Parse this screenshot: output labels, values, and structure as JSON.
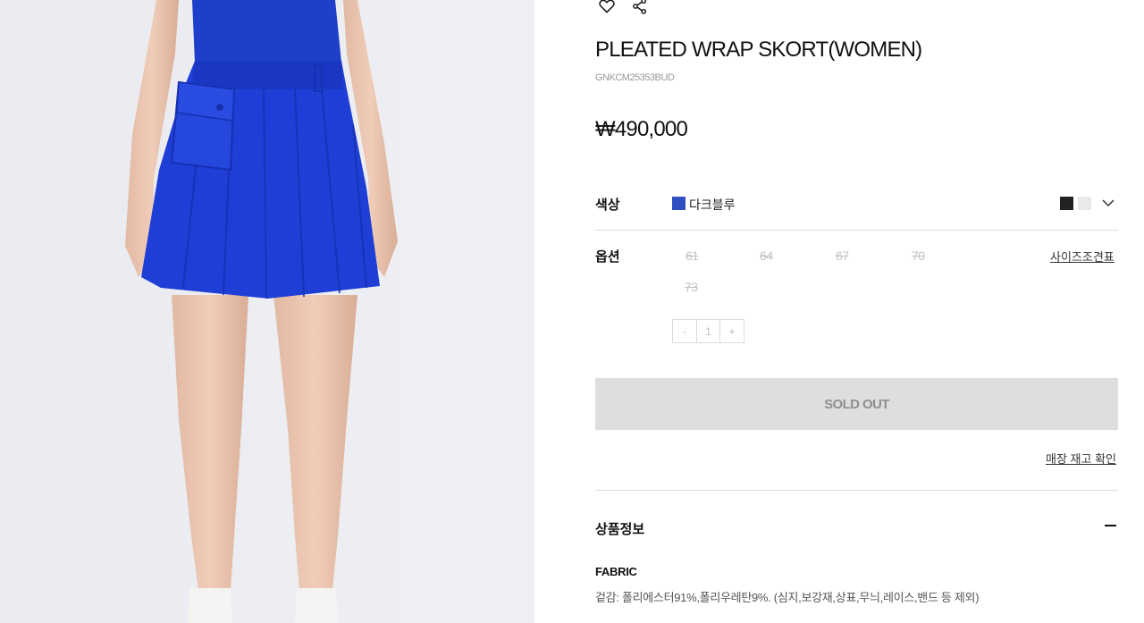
{
  "product": {
    "name": "PLEATED WRAP SKORT(WOMEN)",
    "code": "GNKCM25353BUD",
    "price": "₩490,000"
  },
  "icons": {
    "wishlist": "heart-icon",
    "share": "share-icon",
    "expand": "chevron-down-icon",
    "collapse": "minus-icon"
  },
  "color": {
    "label": "색상",
    "selected_name": "다크블루",
    "selected_hex": "#2f4ec2",
    "swatches": [
      "#222222",
      "#e9e9e9"
    ]
  },
  "options": {
    "label": "옵션",
    "sizes": [
      "61",
      "64",
      "67",
      "70",
      "73"
    ],
    "size_guide": "사이즈조견표"
  },
  "quantity": {
    "minus": "-",
    "value": "1",
    "plus": "+"
  },
  "buttons": {
    "sold_out": "SOLD OUT",
    "store_stock": "매장 재고 확인"
  },
  "info": {
    "title": "상품정보",
    "fabric_heading": "FABRIC",
    "fabric_detail": "겉감: 폴리에스터91%,폴리우레탄9%. (심지,보강재,상표,무늬,레이스,밴드 등 제외)"
  }
}
